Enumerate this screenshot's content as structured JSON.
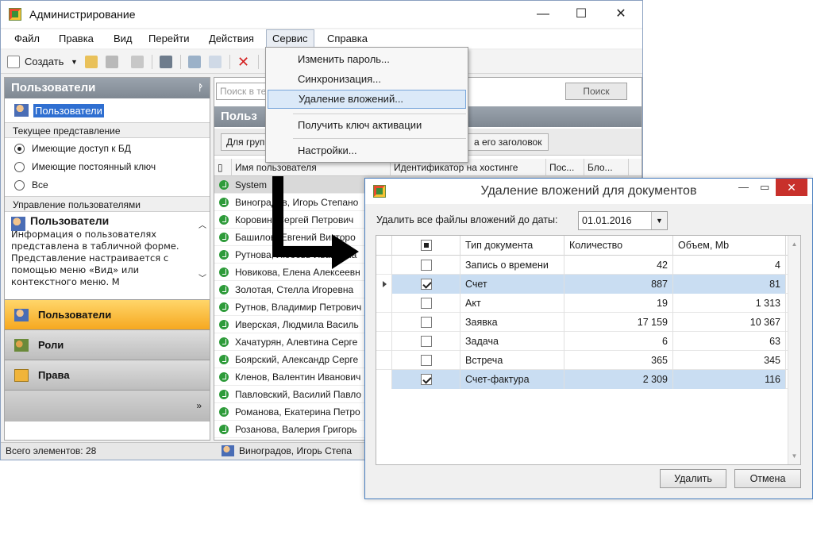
{
  "window": {
    "title": "Администрирование",
    "controls": {
      "minimize": "—",
      "maximize": "☐",
      "close": "✕"
    }
  },
  "menu": [
    "Файл",
    "Правка",
    "Вид",
    "Перейти",
    "Действия",
    "Сервис",
    "Справка"
  ],
  "toolbar": {
    "create_label": "Создать"
  },
  "left_panel": {
    "header": "Пользователи",
    "pin": "ᚹ",
    "selected_item": "Пользователи",
    "current_view_header": "Текущее представление",
    "views": [
      {
        "label": "Имеющие доступ к БД",
        "checked": true
      },
      {
        "label": "Имеющие постоянный ключ",
        "checked": false
      },
      {
        "label": "Все",
        "checked": false
      }
    ],
    "manage_header": "Управление пользователями",
    "info_title": "Пользователи",
    "info_text": "Информация о пользователях представлена в табличной форме. Представление настраивается с помощью меню «Вид» или контекстного меню. М",
    "nav": [
      {
        "label": "Пользователи",
        "active": true
      },
      {
        "label": "Роли",
        "active": false
      },
      {
        "label": "Права",
        "active": false
      }
    ],
    "nav_chevron": "»"
  },
  "list": {
    "search_placeholder": "Поиск в те",
    "search_button": "Поиск",
    "header": "Польз",
    "group_button": "Для груп",
    "group_hint": "а его заголовок",
    "columns": [
      "Имя пользователя",
      "Идентификатор на хостинге",
      "Пос...",
      "Бло..."
    ],
    "rows": [
      "System",
      "Виноградов, Игорь Степано",
      "Коровин, Сергей Петрович",
      "Башилов, Евгений Викторо",
      "Рутнова, Любовь Ивановна",
      "Новикова, Елена Алексеевн",
      "Золотая, Стелла Игоревна",
      "Рутнов, Владимир Петрович",
      "Иверская, Людмила Василь",
      "Хачатурян, Алевтина Серге",
      "Боярский, Александр Серге",
      "Кленов, Валентин Иванович",
      "Павловский, Василий Павло",
      "Романова, Екатерина Петро",
      "Розанова, Валерия Григорь"
    ]
  },
  "status": {
    "total": "Всего элементов: 28",
    "current_user": "Виноградов, Игорь Степа"
  },
  "service_menu": [
    "Изменить пароль...",
    "Синхронизация...",
    "Удаление вложений...",
    "Получить ключ активации",
    "Настройки..."
  ],
  "dialog": {
    "title": "Удаление вложений для документов",
    "controls": {
      "minimize": "—",
      "maximize": "▭",
      "close": "✕"
    },
    "date_label": "Удалить все файлы вложений до даты:",
    "date_value": "01.01.2016",
    "date_button": "▼",
    "columns": [
      "Тип документа",
      "Количество",
      "Объем, Mb"
    ],
    "rows": [
      {
        "checked": false,
        "type": "Запись о времени",
        "count": "42",
        "volume": "4",
        "selected": false
      },
      {
        "checked": true,
        "type": "Счет",
        "count": "887",
        "volume": "81",
        "selected": true,
        "current": true
      },
      {
        "checked": false,
        "type": "Акт",
        "count": "19",
        "volume": "1 313",
        "selected": false
      },
      {
        "checked": false,
        "type": "Заявка",
        "count": "17 159",
        "volume": "10 367",
        "selected": false
      },
      {
        "checked": false,
        "type": "Задача",
        "count": "6",
        "volume": "63",
        "selected": false
      },
      {
        "checked": false,
        "type": "Встреча",
        "count": "365",
        "volume": "345",
        "selected": false
      },
      {
        "checked": true,
        "type": "Счет-фактура",
        "count": "2 309",
        "volume": "116",
        "selected": true
      }
    ],
    "scroll_up": "▲",
    "scroll_down": "▼",
    "delete_button": "Удалить",
    "cancel_button": "Отмена"
  },
  "colors": {
    "accent": "#f6a820",
    "selection": "#c9ddf2",
    "header_gray": "#8a939d",
    "close_red": "#c8302b"
  }
}
